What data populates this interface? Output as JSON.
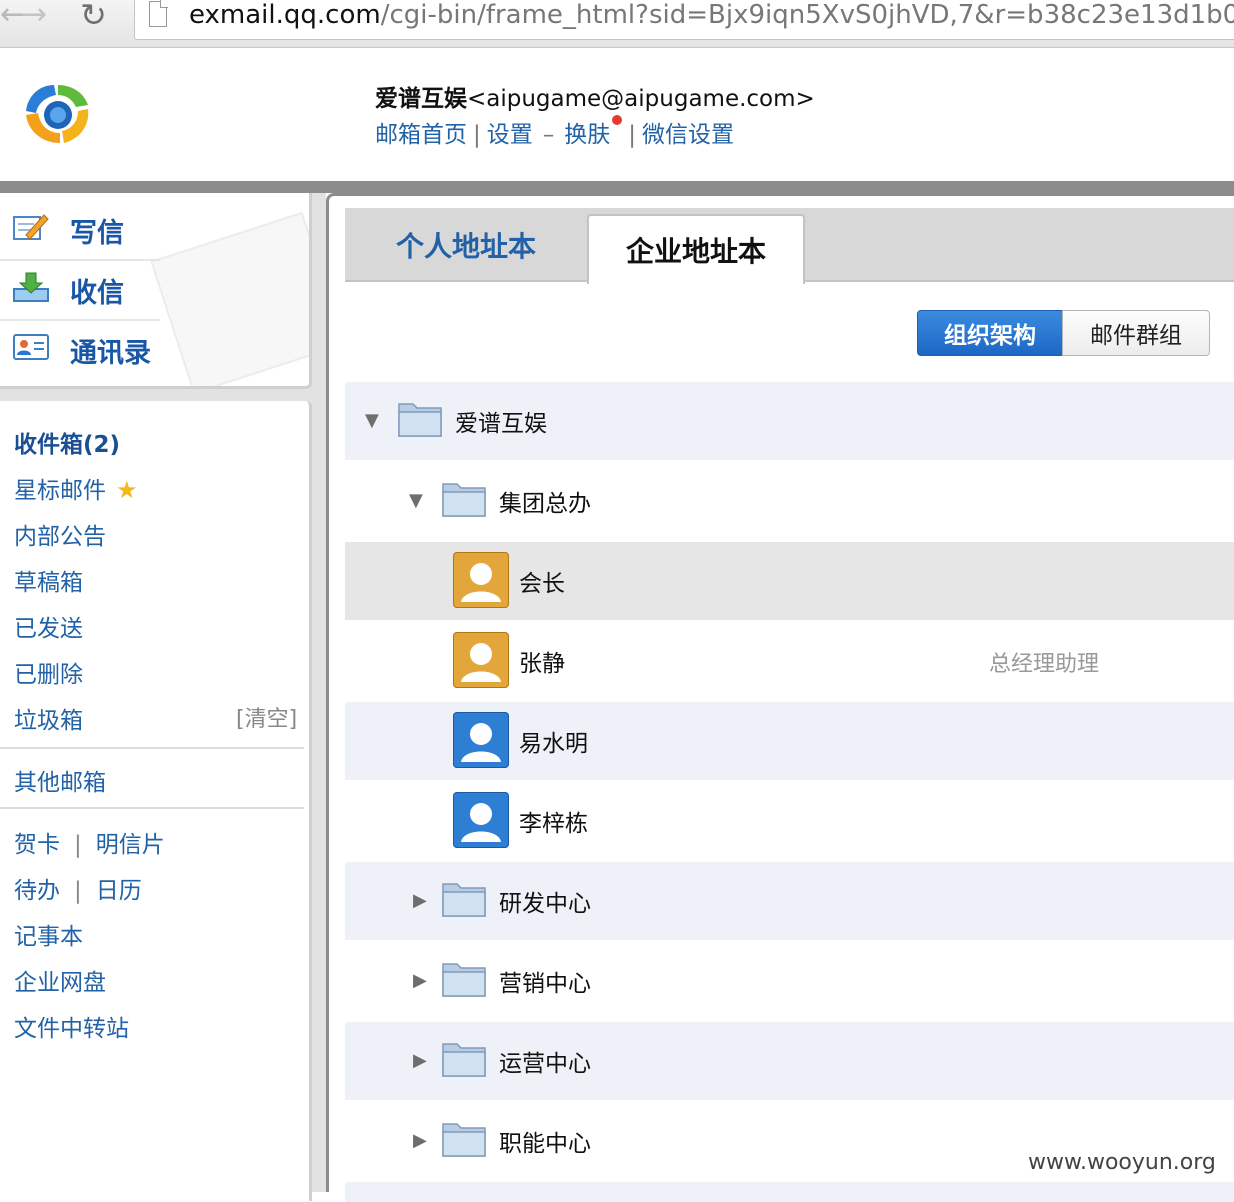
{
  "browser": {
    "url_host": "exmail.qq.com",
    "url_path": "/cgi-bin/frame_html?sid=Bjx9iqn5XvS0jhVD,7&r=b38c23e13d1b0"
  },
  "header": {
    "user_name": "爱谱互娱",
    "user_email": "<aipugame@aipugame.com>",
    "links": {
      "home": "邮箱首页",
      "settings": "设置",
      "dash": "–",
      "skin": "换肤",
      "wechat": "微信设置",
      "sep": "|"
    }
  },
  "quick_actions": {
    "compose": "写信",
    "inbox": "收信",
    "contacts": "通讯录"
  },
  "folders": {
    "inbox": "收件箱(2)",
    "starred": "星标邮件",
    "star_glyph": "★",
    "notice": "内部公告",
    "drafts": "草稿箱",
    "sent": "已发送",
    "deleted": "已删除",
    "trash": "垃圾箱",
    "clear": "[清空]",
    "other": "其他邮箱",
    "card": "贺卡",
    "postcard": "明信片",
    "todo": "待办",
    "calendar": "日历",
    "notes": "记事本",
    "disk": "企业网盘",
    "transfer": "文件中转站",
    "pipe": "|"
  },
  "tabs": {
    "personal": "个人地址本",
    "enterprise": "企业地址本"
  },
  "view_toggle": {
    "org": "组织架构",
    "groups": "邮件群组"
  },
  "tree": {
    "root": "爱谱互娱",
    "dept1": "集团总办",
    "members": [
      {
        "name": "会长",
        "title": ""
      },
      {
        "name": "张静",
        "title": "总经理助理"
      },
      {
        "name": "易水明",
        "title": ""
      },
      {
        "name": "李梓栋",
        "title": ""
      }
    ],
    "collapsed": [
      "研发中心",
      "营销中心",
      "运营中心",
      "职能中心"
    ],
    "arrow_open": "▼",
    "arrow_closed": "▶"
  },
  "watermark": "www.wooyun.org",
  "colors": {
    "link": "#2262a7",
    "primary_button": "#2a78d3",
    "row_alt": "#eef2f8",
    "row_selected": "#e6e6e6",
    "avatar_gold": "#e3a63a",
    "avatar_blue": "#2e7fd4"
  }
}
